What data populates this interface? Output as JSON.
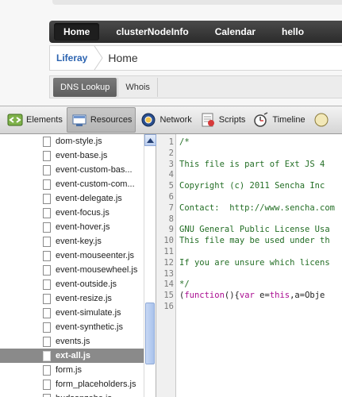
{
  "navbar": {
    "items": [
      {
        "label": "Home",
        "active": true
      },
      {
        "label": "clusterNodeInfo",
        "active": false
      },
      {
        "label": "Calendar",
        "active": false
      },
      {
        "label": "hello",
        "active": false
      }
    ]
  },
  "breadcrumb": {
    "site": "Liferay",
    "current": "Home"
  },
  "subtabs": [
    {
      "label": "DNS Lookup",
      "active": true
    },
    {
      "label": "Whois",
      "active": false
    }
  ],
  "devtools": {
    "tabs": [
      {
        "label": "Elements",
        "icon": "elements-icon",
        "active": false
      },
      {
        "label": "Resources",
        "icon": "resources-icon",
        "active": true
      },
      {
        "label": "Network",
        "icon": "network-icon",
        "active": false
      },
      {
        "label": "Scripts",
        "icon": "scripts-icon",
        "active": false
      },
      {
        "label": "Timeline",
        "icon": "timeline-icon",
        "active": false
      }
    ],
    "files": [
      {
        "name": "dom-style.js"
      },
      {
        "name": "event-base.js"
      },
      {
        "name": "event-custom-bas..."
      },
      {
        "name": "event-custom-com..."
      },
      {
        "name": "event-delegate.js"
      },
      {
        "name": "event-focus.js"
      },
      {
        "name": "event-hover.js"
      },
      {
        "name": "event-key.js"
      },
      {
        "name": "event-mouseenter.js"
      },
      {
        "name": "event-mousewheel.js"
      },
      {
        "name": "event-outside.js"
      },
      {
        "name": "event-resize.js"
      },
      {
        "name": "event-simulate.js"
      },
      {
        "name": "event-synthetic.js"
      },
      {
        "name": "events.js"
      },
      {
        "name": "ext-all.js",
        "selected": true
      },
      {
        "name": "form.js"
      },
      {
        "name": "form_placeholders.js"
      },
      {
        "name": "hudsonzehe.js"
      }
    ],
    "code_lines": [
      {
        "n": "1",
        "text": "/*"
      },
      {
        "n": "2",
        "text": ""
      },
      {
        "n": "3",
        "text": "This file is part of Ext JS 4"
      },
      {
        "n": "4",
        "text": ""
      },
      {
        "n": "5",
        "text": "Copyright (c) 2011 Sencha Inc"
      },
      {
        "n": "6",
        "text": ""
      },
      {
        "n": "7",
        "text": "Contact:  http://www.sencha.com"
      },
      {
        "n": "8",
        "text": ""
      },
      {
        "n": "9",
        "text": "GNU General Public License Usa"
      },
      {
        "n": "10",
        "text": "This file may be used under th"
      },
      {
        "n": "11",
        "text": ""
      },
      {
        "n": "12",
        "text": "If you are unsure which licens"
      },
      {
        "n": "13",
        "text": ""
      },
      {
        "n": "14",
        "text": "*/"
      },
      {
        "n": "15",
        "text": "",
        "js": true,
        "p1": "(",
        "k1": "function",
        "p2": "(){",
        "k2": "var",
        "p3": " e=",
        "k3": "this",
        "p4": ",a=Obje"
      },
      {
        "n": "16",
        "text": ""
      }
    ]
  }
}
